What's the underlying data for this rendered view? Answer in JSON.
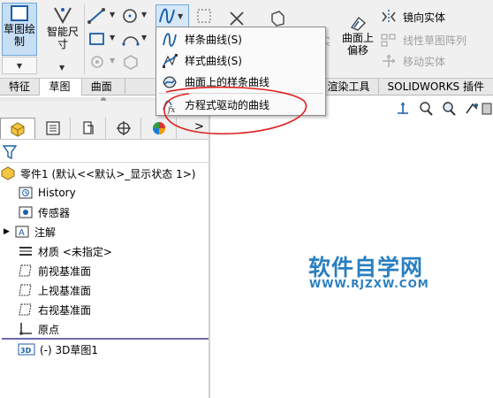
{
  "ribbon": {
    "sketch_label": "草图绘制",
    "smart_dim_label": "智能尺寸",
    "surface_on_label": "曲面上偏移",
    "mirror_label": "镜向实体",
    "linear_pattern_label": "线性草图阵列",
    "move_label": "移动实体",
    "clipped_label": "实",
    "tabs": [
      "特征",
      "草图",
      "曲面",
      "",
      "估",
      "渲染工具",
      "SOLIDWORKS 插件"
    ]
  },
  "spline_menu": {
    "items": [
      {
        "label": "样条曲线(S)",
        "icon": "spline-icon"
      },
      {
        "label": "样式曲线(S)",
        "icon": "style-spline-icon"
      },
      {
        "label": "曲面上的样条曲线",
        "icon": "surface-spline-icon"
      },
      {
        "label": "方程式驱动的曲线",
        "icon": "equation-curve-icon"
      }
    ]
  },
  "feature_tree": {
    "root": "零件1 (默认<<默认>_显示状态 1>)",
    "items": [
      {
        "label": "History",
        "icon": "history-icon"
      },
      {
        "label": "传感器",
        "icon": "sensor-icon"
      },
      {
        "label": "注解",
        "icon": "annotation-icon"
      },
      {
        "label": "材质 <未指定>",
        "icon": "material-icon"
      },
      {
        "label": "前视基准面",
        "icon": "plane-icon"
      },
      {
        "label": "上视基准面",
        "icon": "plane-icon"
      },
      {
        "label": "右视基准面",
        "icon": "plane-icon"
      },
      {
        "label": "原点",
        "icon": "origin-icon"
      },
      {
        "label": "(-) 3D草图1",
        "icon": "3d-sketch-icon"
      }
    ],
    "more_label": ">"
  },
  "watermark": {
    "title": "软件自学网",
    "url": "WWW.RJZXW.COM"
  },
  "colors": {
    "accent": "#2a7fc0",
    "annotation_red": "#e02020",
    "selection": "#c7def5"
  }
}
